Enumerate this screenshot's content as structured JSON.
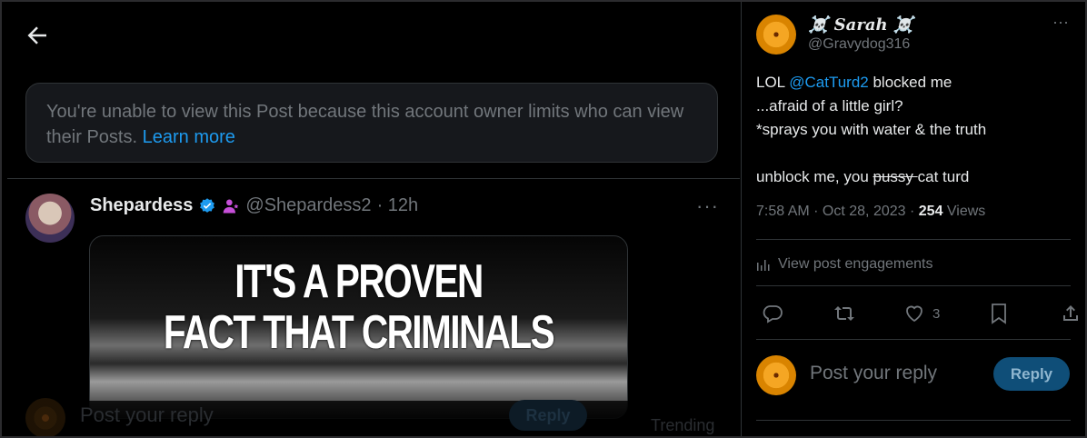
{
  "left": {
    "notice": {
      "text": "You're unable to view this Post because this account owner limits who can view their Posts.",
      "link": "Learn more"
    },
    "tweet": {
      "name": "Shepardess",
      "handle": "@Shepardess2",
      "time": "· 12h",
      "more": "···",
      "meme_line1": "IT'S A PROVEN",
      "meme_line2": "FACT THAT CRIMINALS"
    },
    "bottom_bar": {
      "placeholder": "Post your reply",
      "reply_label": "Reply",
      "trending": "Trending"
    }
  },
  "right": {
    "author": {
      "name": "☠️ Sarah ☠️",
      "handle": "@Gravydog316",
      "more": "···"
    },
    "body": {
      "line1_pre": "LOL ",
      "mention": "@CatTurd2",
      "line1_post": " blocked me",
      "line2": "...afraid of a little girl?",
      "line3": "*sprays you with water & the truth",
      "line4_pre": "unblock me, you ",
      "line4_strike": "pussy ",
      "line4_post": "cat turd"
    },
    "meta": {
      "timestamp": "7:58 AM · Oct 28, 2023 · ",
      "views_count": "254",
      "views_label": " Views"
    },
    "engagements_label": "View post engagements",
    "actions": {
      "like_count": "3"
    },
    "reply": {
      "placeholder": "Post your reply",
      "button": "Reply"
    }
  },
  "colors": {
    "accent": "#1d9bf0",
    "muted": "#71767b",
    "text": "#e7e9ea",
    "background": "#000000",
    "border": "#2f3336"
  }
}
